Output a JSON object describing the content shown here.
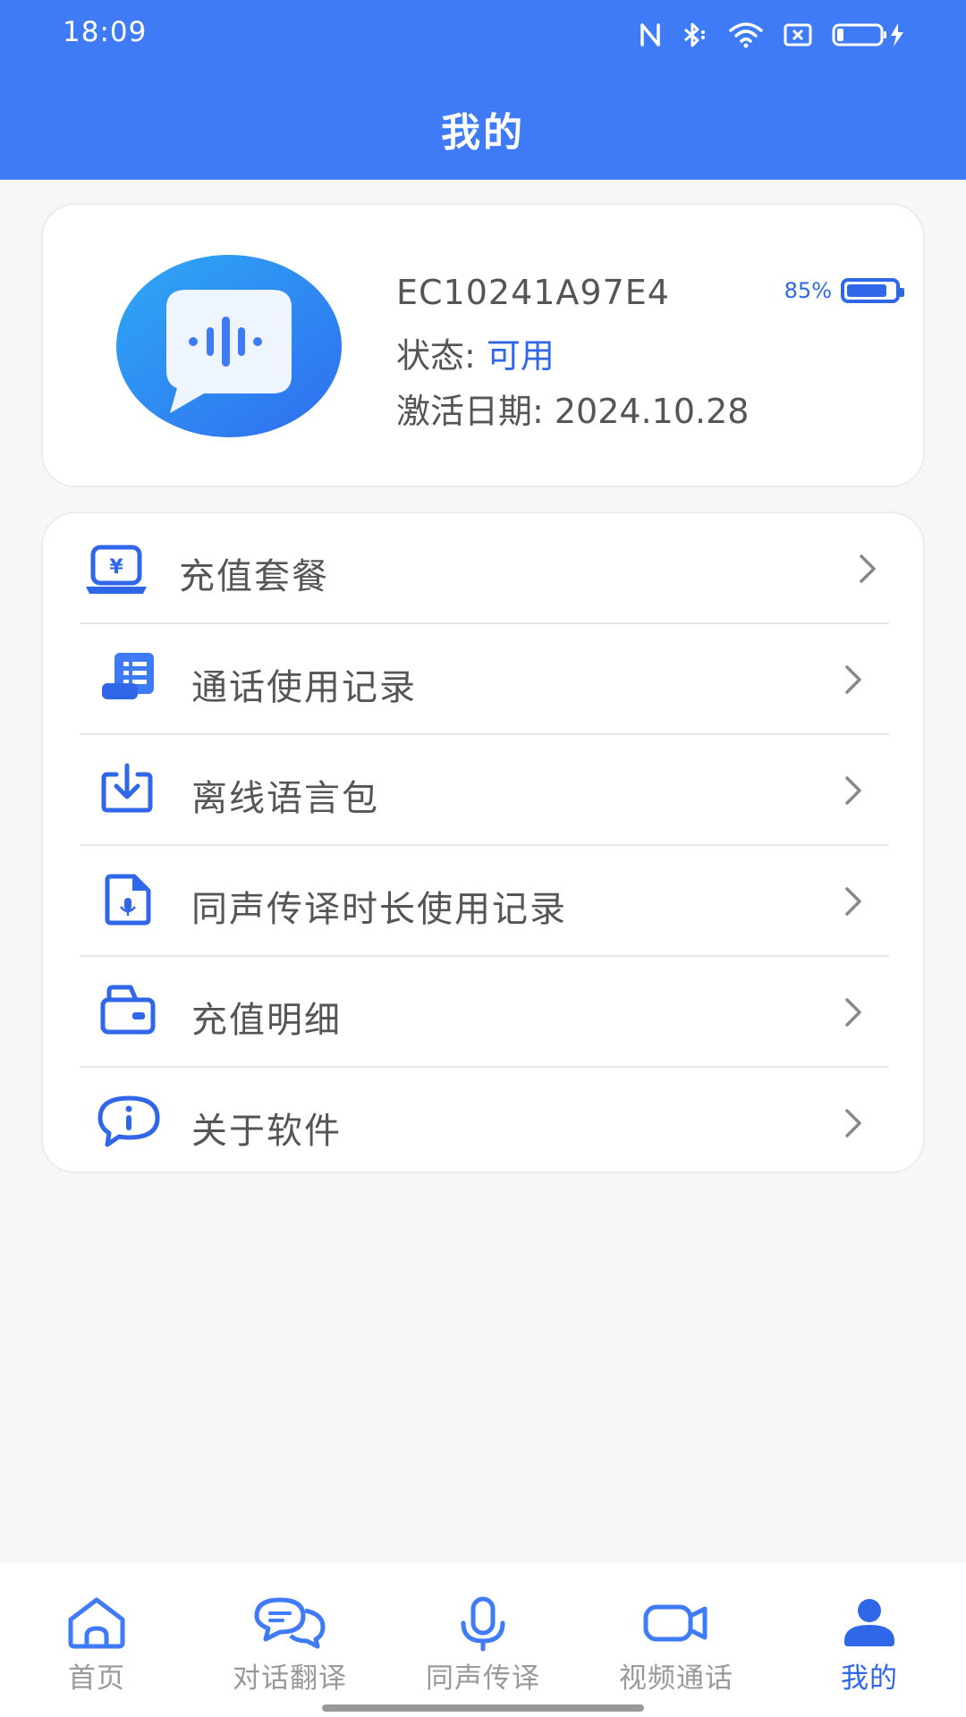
{
  "status_bar": {
    "time": "18:09"
  },
  "header": {
    "title": "我的"
  },
  "device": {
    "id": "EC10241A97E4",
    "battery_percent": "85%",
    "battery_level": 0.85,
    "status_label": "状态: ",
    "status_value": "可用",
    "activation_text": "激活日期: 2024.10.28"
  },
  "menu": [
    {
      "label": "充值套餐",
      "icon": "recharge-icon"
    },
    {
      "label": "通话使用记录",
      "icon": "call-record-icon"
    },
    {
      "label": "离线语言包",
      "icon": "download-icon"
    },
    {
      "label": "同声传译时长使用记录",
      "icon": "interpret-record-icon"
    },
    {
      "label": "充值明细",
      "icon": "wallet-icon"
    },
    {
      "label": "关于软件",
      "icon": "info-icon"
    }
  ],
  "tabs": [
    {
      "label": "首页",
      "icon": "home-icon"
    },
    {
      "label": "对话翻译",
      "icon": "chat-icon"
    },
    {
      "label": "同声传译",
      "icon": "microphone-icon"
    },
    {
      "label": "视频通话",
      "icon": "video-icon"
    },
    {
      "label": "我的",
      "icon": "person-icon",
      "active": true
    }
  ],
  "colors": {
    "primary": "#3f7bf7",
    "accent": "#2f67e8",
    "inactive": "#999999"
  }
}
